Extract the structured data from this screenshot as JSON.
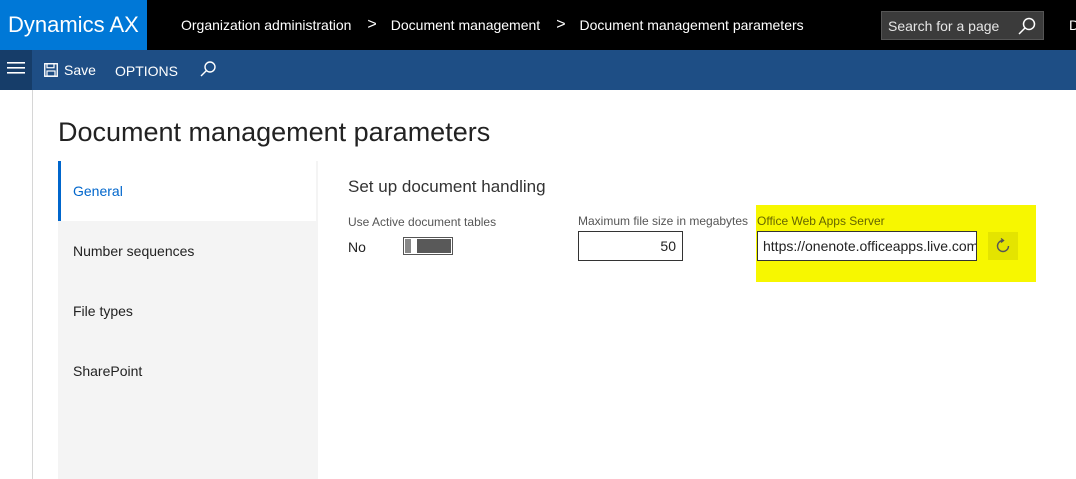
{
  "app": {
    "title": "Dynamics AX"
  },
  "breadcrumb": {
    "items": [
      "Organization administration",
      "Document management",
      "Document management parameters"
    ],
    "separator": ">"
  },
  "search": {
    "placeholder": "Search for a page"
  },
  "topbar_tail": "D",
  "actionbar": {
    "save_label": "Save",
    "options_label": "OPTIONS"
  },
  "page": {
    "title": "Document management parameters"
  },
  "nav": {
    "items": [
      {
        "label": "General",
        "active": true
      },
      {
        "label": "Number sequences",
        "active": false
      },
      {
        "label": "File types",
        "active": false
      },
      {
        "label": "SharePoint",
        "active": false
      }
    ]
  },
  "section": {
    "title": "Set up document handling",
    "active_doc_tables": {
      "label": "Use Active document tables",
      "value": "No"
    },
    "max_file_size": {
      "label": "Maximum file size in megabytes",
      "value": "50"
    },
    "office_web_apps": {
      "label": "Office Web Apps Server",
      "value": "https://onenote.officeapps.live.com"
    }
  },
  "colors": {
    "brand": "#0078d7",
    "actionbar": "#1e4e85",
    "highlight": "#f7f700",
    "link": "#0066cc"
  }
}
